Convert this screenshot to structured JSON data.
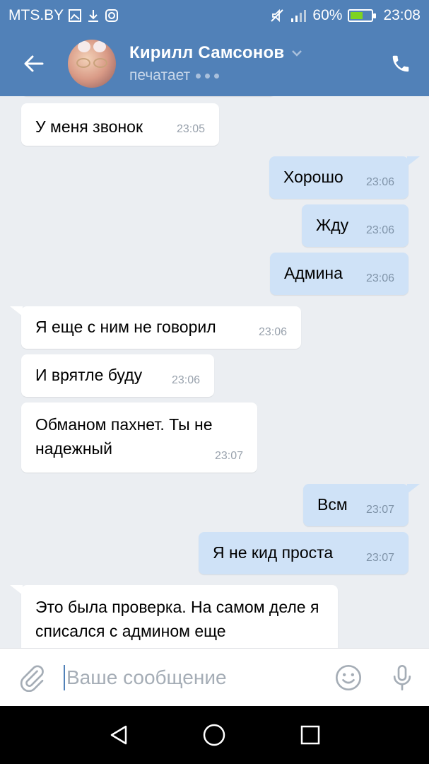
{
  "status_bar": {
    "carrier": "MTS.BY",
    "battery": "60%",
    "battery_level": 0.6,
    "time": "23:08",
    "icons": [
      "image-icon",
      "download-icon",
      "instagram-icon",
      "mute-icon",
      "signal-icon",
      "battery-icon"
    ]
  },
  "header": {
    "name": "Кирилл Самсонов",
    "status": "печатает",
    "icons": [
      "back-arrow-icon",
      "chevron-down-icon",
      "phone-icon"
    ]
  },
  "messages": [
    {
      "text": "У меня звонок",
      "time": "23:05",
      "dir": "in"
    },
    {
      "text": "Хорошо",
      "time": "23:06",
      "dir": "out"
    },
    {
      "text": "Жду",
      "time": "23:06",
      "dir": "out"
    },
    {
      "text": "Админа",
      "time": "23:06",
      "dir": "out"
    },
    {
      "text": "Я еще с ним не говорил",
      "time": "23:06",
      "dir": "in"
    },
    {
      "text": "И врятле буду",
      "time": "23:06",
      "dir": "in"
    },
    {
      "text": "Обманом пахнет. Ты не надежный",
      "time": "23:07",
      "dir": "in"
    },
    {
      "text": "Всм",
      "time": "23:07",
      "dir": "out"
    },
    {
      "text": "Я не кид проста",
      "time": "23:07",
      "dir": "out"
    },
    {
      "text": "Это была проверка. На самом деле я списался с админом еще",
      "time": "",
      "dir": "in"
    }
  ],
  "composer": {
    "placeholder": "Ваше сообщение",
    "icons": [
      "attach-icon",
      "emoji-icon",
      "microphone-icon"
    ]
  },
  "nav": {
    "icons": [
      "back-triangle-icon",
      "home-circle-icon",
      "recents-square-icon"
    ]
  },
  "colors": {
    "header_bg": "#5181b8",
    "chat_bg": "#ebeef2",
    "outgoing_bubble": "#cfe2f7",
    "incoming_bubble": "#ffffff"
  }
}
